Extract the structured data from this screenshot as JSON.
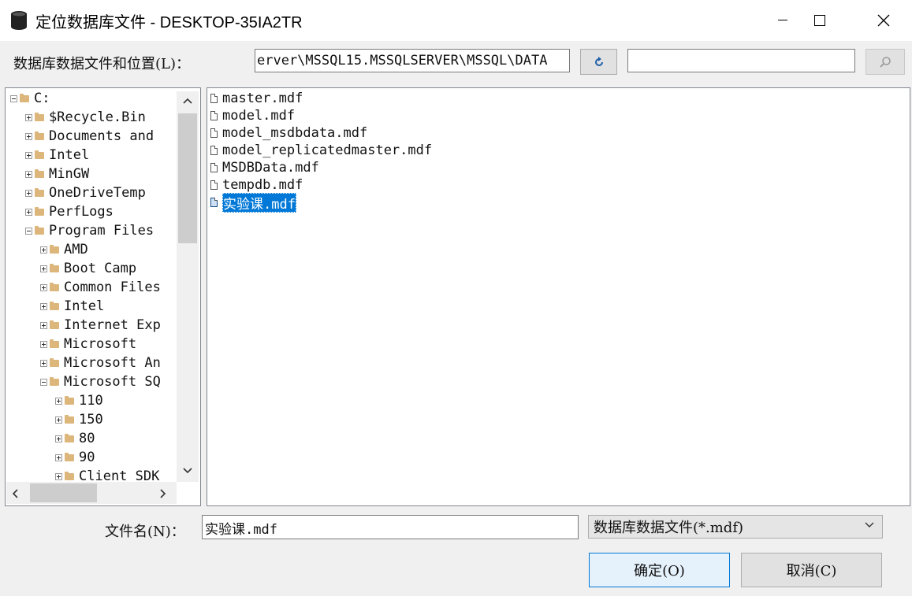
{
  "window": {
    "title": "定位数据库文件 - DESKTOP-35IA2TR",
    "title_icon": "database-icon"
  },
  "location": {
    "label": "数据库数据文件和位置(L)：",
    "path_value": "erver\\MSSQL15.MSSQLSERVER\\MSSQL\\DATA",
    "search_value": ""
  },
  "tree": {
    "items": [
      {
        "label": "C:",
        "expanded": true
      },
      {
        "label": "$Recycle.Bin",
        "expanded": false
      },
      {
        "label": "Documents and",
        "expanded": false
      },
      {
        "label": "Intel",
        "expanded": false
      },
      {
        "label": "MinGW",
        "expanded": false
      },
      {
        "label": "OneDriveTemp",
        "expanded": false
      },
      {
        "label": "PerfLogs",
        "expanded": false
      },
      {
        "label": "Program Files",
        "expanded": true
      },
      {
        "label": "AMD",
        "expanded": false
      },
      {
        "label": "Boot Camp",
        "expanded": false
      },
      {
        "label": "Common Files",
        "expanded": false
      },
      {
        "label": "Intel",
        "expanded": false
      },
      {
        "label": "Internet Exp",
        "expanded": false
      },
      {
        "label": "Microsoft",
        "expanded": false
      },
      {
        "label": "Microsoft An",
        "expanded": false
      },
      {
        "label": "Microsoft SQ",
        "expanded": true
      },
      {
        "label": "110",
        "expanded": false
      },
      {
        "label": "150",
        "expanded": false
      },
      {
        "label": "80",
        "expanded": false
      },
      {
        "label": "90",
        "expanded": false
      },
      {
        "label": "Client SDK",
        "expanded": false
      }
    ]
  },
  "files": [
    {
      "name": "master.mdf",
      "selected": false
    },
    {
      "name": "model.mdf",
      "selected": false
    },
    {
      "name": "model_msdbdata.mdf",
      "selected": false
    },
    {
      "name": "model_replicatedmaster.mdf",
      "selected": false
    },
    {
      "name": "MSDBData.mdf",
      "selected": false
    },
    {
      "name": "tempdb.mdf",
      "selected": false
    },
    {
      "name": "实验课.mdf",
      "selected": true
    }
  ],
  "filename": {
    "label": "文件名(N)：",
    "value": "实验课.mdf"
  },
  "filetype": {
    "selected": "数据库数据文件(*.mdf)"
  },
  "buttons": {
    "ok": "确定(O)",
    "cancel": "取消(C)"
  },
  "colors": {
    "selection": "#0078d7",
    "folder": "#dcb67a",
    "accent_border": "#0078d7"
  }
}
